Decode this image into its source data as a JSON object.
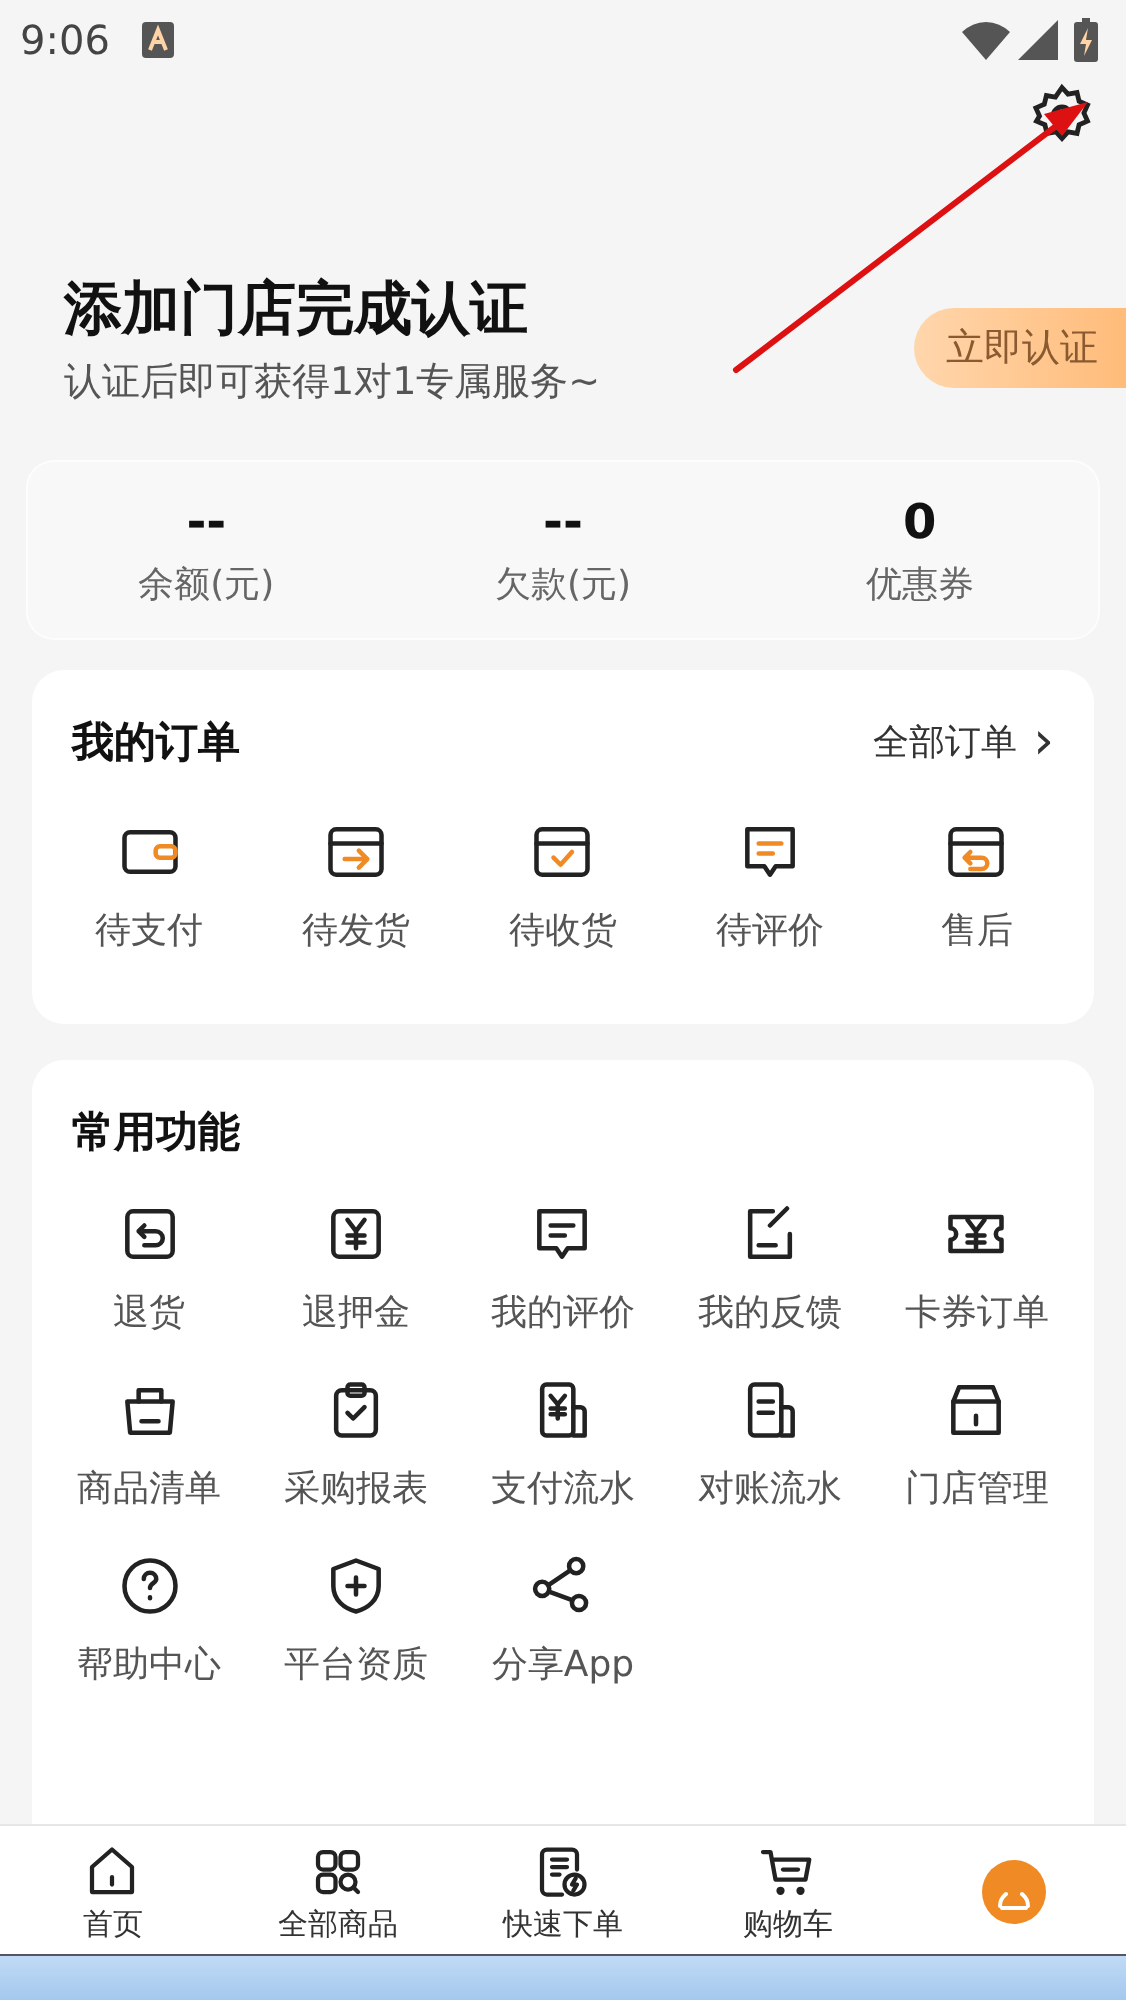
{
  "status_bar": {
    "time": "9:06"
  },
  "header": {
    "title": "添加门店完成认证",
    "subtitle": "认证后即可获得1对1专属服务~",
    "action": "立即认证"
  },
  "stats": [
    {
      "value": "--",
      "label": "余额(元)"
    },
    {
      "value": "--",
      "label": "欠款(元)"
    },
    {
      "value": "0",
      "label": "优惠券"
    }
  ],
  "orders": {
    "title": "我的订单",
    "link": "全部订单",
    "link_icon": "›",
    "items": [
      "待支付",
      "待发货",
      "待收货",
      "待评价",
      "售后"
    ]
  },
  "functions": {
    "title": "常用功能",
    "items": [
      "退货",
      "退押金",
      "我的评价",
      "我的反馈",
      "卡券订单",
      "商品清单",
      "采购报表",
      "支付流水",
      "对账流水",
      "门店管理",
      "帮助中心",
      "平台资质",
      "分享App"
    ]
  },
  "tab_bar": {
    "items": [
      {
        "label": "首页",
        "selected": false
      },
      {
        "label": "全部商品",
        "selected": false
      },
      {
        "label": "快速下单",
        "selected": false
      },
      {
        "label": "购物车",
        "selected": false
      },
      {
        "kind": "avatar",
        "selected": true
      }
    ]
  }
}
